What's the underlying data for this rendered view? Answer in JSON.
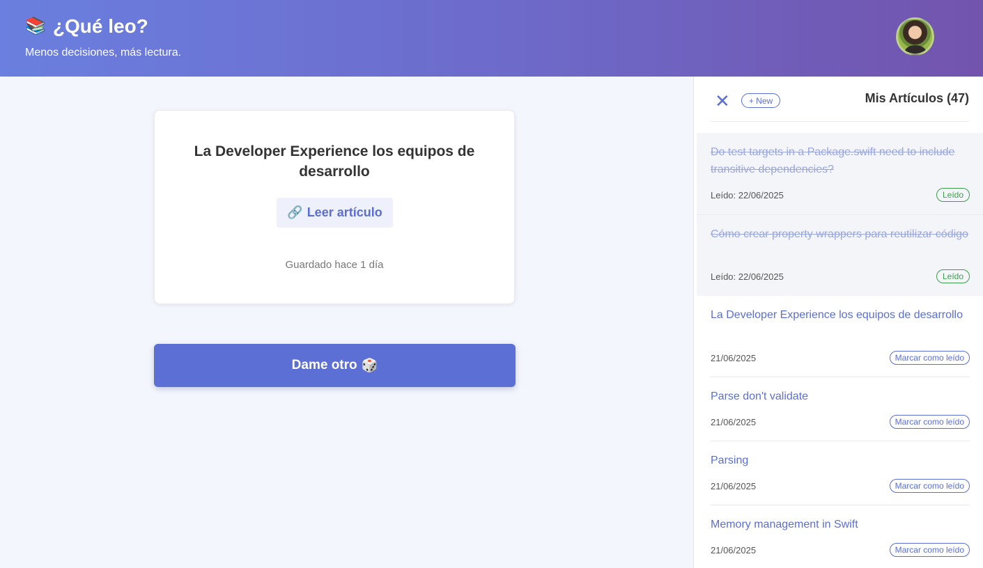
{
  "header": {
    "icon": "📚",
    "title": "¿Qué leo?",
    "subtitle": "Menos decisiones, más lectura."
  },
  "card": {
    "title": "La Developer Experience los equipos de desarrollo",
    "read_link_icon": "🔗",
    "read_link_label": "Leer artículo",
    "saved_text": "Guardado hace 1 día"
  },
  "another_button": {
    "label": "Dame otro",
    "icon": "🎲"
  },
  "sidebar": {
    "close_icon": "✕",
    "new_label": "+ New",
    "title": "Mis Artículos (47)",
    "articles": [
      {
        "title": "Do test targets in a Package.swift need to include transitive dependencies?",
        "date": "Leído: 22/06/2025",
        "read": true,
        "action": "Leído"
      },
      {
        "title": "Cómo crear property wrappers para reutilizar código",
        "date": "Leído: 22/06/2025",
        "read": true,
        "action": "Leído"
      },
      {
        "title": "La Developer Experience los equipos de desarrollo",
        "date": "21/06/2025",
        "read": false,
        "action": "Marcar como leído"
      },
      {
        "title": "Parse don't validate",
        "date": "21/06/2025",
        "read": false,
        "action": "Marcar como leído"
      },
      {
        "title": "Parsing",
        "date": "21/06/2025",
        "read": false,
        "action": "Marcar como leído"
      },
      {
        "title": "Memory management in Swift",
        "date": "21/06/2025",
        "read": false,
        "action": "Marcar como leído"
      }
    ]
  },
  "colors": {
    "accent": "#5b6fd3",
    "header_start": "#6a7fdf",
    "header_end": "#7254ad",
    "read_badge": "#3c9d4a"
  }
}
